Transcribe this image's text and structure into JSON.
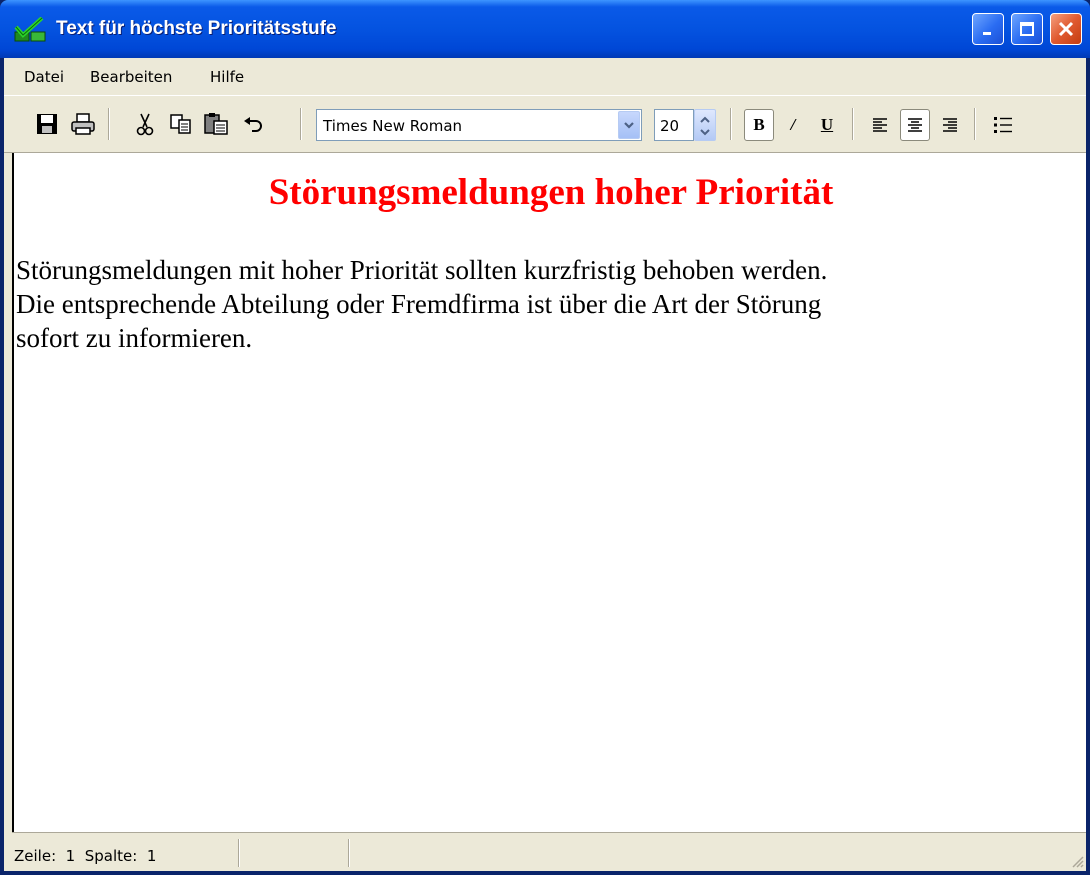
{
  "window": {
    "title": "Text für höchste Prioritätsstufe",
    "icon": "checkmark-app-icon",
    "controls": [
      "minimize",
      "maximize",
      "close"
    ]
  },
  "menu": {
    "items": [
      {
        "label": "Datei"
      },
      {
        "label": "Bearbeiten"
      },
      {
        "label": "Hilfe"
      }
    ]
  },
  "toolbar": {
    "icons": [
      "save-icon",
      "print-icon",
      "cut-icon",
      "copy-icon",
      "paste-icon",
      "undo-icon"
    ],
    "font_name": "Times New Roman",
    "font_size": "20",
    "bold_label": "B",
    "italic_label": "/",
    "underline_label": "U",
    "alignment_selected": "center",
    "list_icon": "bullet-list-icon"
  },
  "document": {
    "heading": "Störungsmeldungen hoher Priorität",
    "heading_color": "#ff0000",
    "lines": [
      "Störungsmeldungen mit hoher Priorität sollten kurzfristig behoben werden.",
      "Die entsprechende Abteilung oder Fremdfirma ist über die Art der Störung",
      "sofort zu informieren."
    ]
  },
  "status": {
    "line_label": "Zeile:",
    "line_value": "1",
    "column_label": "Spalte:",
    "column_value": "1"
  },
  "colors": {
    "title_bar": "#0453e0",
    "frame": "#ece9d8",
    "close_button": "#e05a30"
  }
}
